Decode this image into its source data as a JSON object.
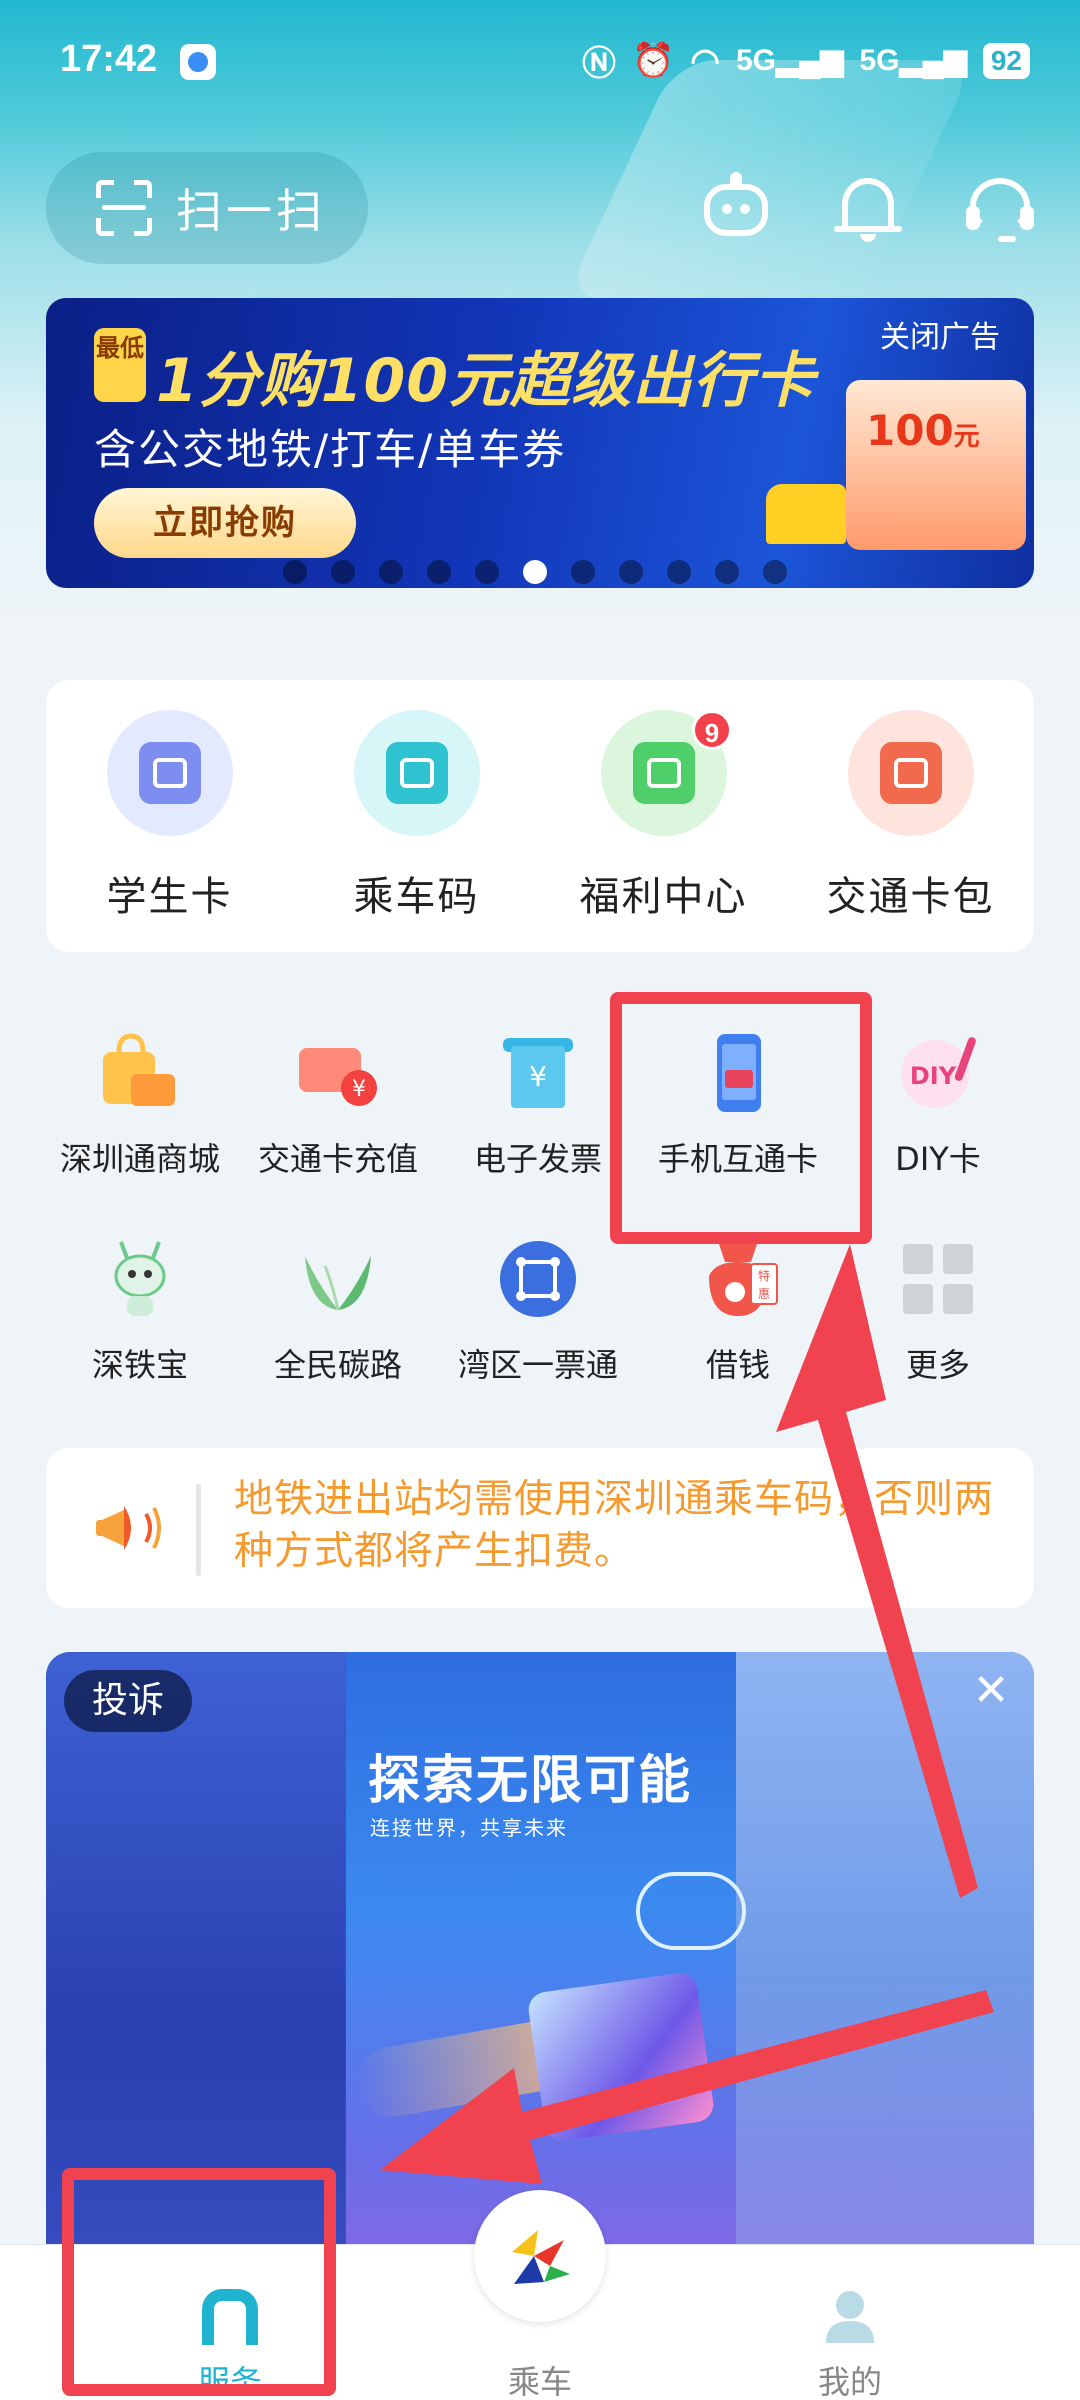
{
  "status_bar": {
    "time": "17:42",
    "icons": [
      "nfc-icon",
      "alarm-icon",
      "wifi-icon",
      "signal-5g-icon",
      "signal-5g-icon"
    ],
    "signal_labels": [
      "5G",
      "5G"
    ],
    "battery": "92"
  },
  "header": {
    "scan_label": "扫一扫",
    "icons": [
      "robot-assistant-icon",
      "bell-icon",
      "headset-icon"
    ]
  },
  "banner": {
    "tag": "最低",
    "title": "1分购100元超级出行卡",
    "subtitle": "含公交地铁/打车/单车券",
    "cta": "立即抢购",
    "close_label": "关闭广告",
    "card_value": "100",
    "card_unit": "元",
    "page_count": 11,
    "active_page": 6
  },
  "quick_services": [
    {
      "label": "学生卡",
      "icon": "student-card-icon",
      "color": "#7d8ef0",
      "bg": "#e3e9ff"
    },
    {
      "label": "乘车码",
      "icon": "ride-code-icon",
      "color": "#2fc3d2",
      "bg": "#d6f6f8"
    },
    {
      "label": "福利中心",
      "icon": "gift-icon",
      "color": "#4fcf6a",
      "bg": "#dcf6dd",
      "badge": "9"
    },
    {
      "label": "交通卡包",
      "icon": "wallet-icon",
      "color": "#f26a4d",
      "bg": "#ffe4de"
    }
  ],
  "services": [
    {
      "label": "深圳通商城",
      "icon": "shopping-bag-icon"
    },
    {
      "label": "交通卡充值",
      "icon": "card-recharge-icon"
    },
    {
      "label": "电子发票",
      "icon": "invoice-icon"
    },
    {
      "label": "手机互通卡",
      "icon": "phone-card-icon"
    },
    {
      "label": "DIY卡",
      "icon": "diy-card-icon",
      "icon_text": "DIY"
    },
    {
      "label": "深铁宝",
      "icon": "mascot-icon"
    },
    {
      "label": "全民碳路",
      "icon": "leaf-icon"
    },
    {
      "label": "湾区一票通",
      "icon": "bay-area-ticket-icon"
    },
    {
      "label": "借钱",
      "icon": "loan-icon",
      "icon_text": "特惠"
    },
    {
      "label": "更多",
      "icon": "more-grid-icon"
    }
  ],
  "notice": {
    "icon": "megaphone-icon",
    "text": "地铁进出站均需使用深圳通乘车码，否则两种方式都将产生扣费。"
  },
  "promo": {
    "tag": "投诉",
    "title": "探索无限可能",
    "subtitle": "连接世界，共享未来",
    "close_icon": "close-icon"
  },
  "tabbar": {
    "tabs": [
      {
        "label": "服务",
        "icon": "home-icon",
        "active": true
      },
      {
        "label": "乘车",
        "icon": "shenzhentong-logo-icon",
        "active": false
      },
      {
        "label": "我的",
        "icon": "profile-icon",
        "active": false
      }
    ]
  },
  "annotation_color": "#f0434f"
}
